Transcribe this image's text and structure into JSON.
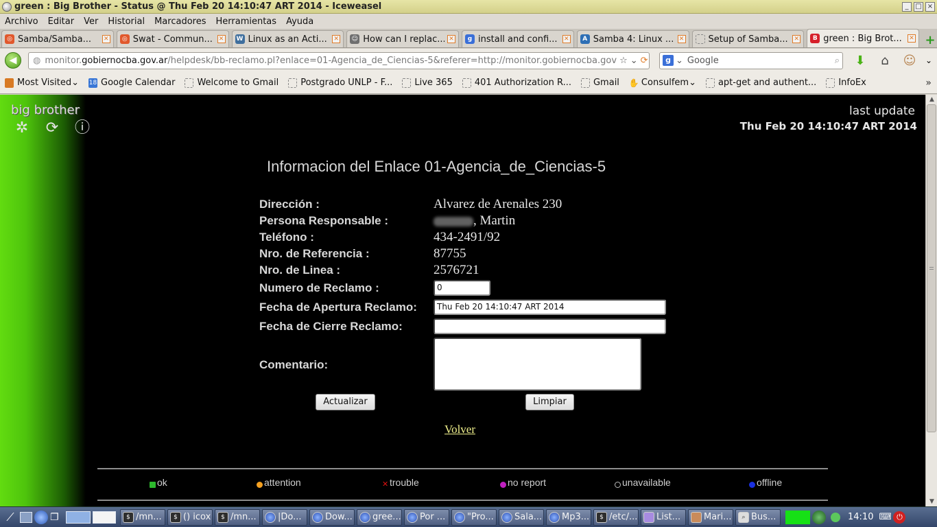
{
  "window": {
    "title": "green : Big Brother - Status @ Thu Feb 20 14:10:47 ART 2014 - Iceweasel",
    "buttons": [
      "_",
      "□",
      "×"
    ]
  },
  "menu": [
    "Archivo",
    "Editar",
    "Ver",
    "Historial",
    "Marcadores",
    "Herramientas",
    "Ayuda"
  ],
  "tabs": [
    {
      "label": "Samba/Samba..."
    },
    {
      "label": "Swat - Commun..."
    },
    {
      "label": "Linux as an Acti..."
    },
    {
      "label": "How can I replac..."
    },
    {
      "label": "install and confi..."
    },
    {
      "label": "Samba 4: Linux ..."
    },
    {
      "label": "Setup of Samba..."
    },
    {
      "label": "green : Big Brot...",
      "active": true
    }
  ],
  "nav": {
    "url_prefix": "monitor.",
    "url_host": "gobiernocba.gov.ar",
    "url_path": "/helpdesk/bb-reclamo.pl?enlace=01-Agencia_de_Ciencias-5&referer=http://monitor.gobiernocba.gov",
    "search_placeholder": "Google"
  },
  "bookmarks": [
    "Most Visited",
    "Google Calendar",
    "Welcome to Gmail",
    "Postgrado UNLP - F...",
    "Live 365",
    "401 Authorization R...",
    "Gmail",
    "Consulfem",
    "apt-get and authent...",
    "InfoEx"
  ],
  "page": {
    "brand": "big brother",
    "last_update_label": "last update",
    "last_update_value": "Thu Feb 20 14:10:47 ART 2014",
    "heading": "Informacion del Enlace 01-Agencia_de_Ciencias-5",
    "fields": {
      "direccion_label": "Dirección :",
      "direccion_value": "Alvarez de Arenales 230",
      "persona_label": "Persona Responsable :",
      "persona_value": ", Martin",
      "telefono_label": "Teléfono :",
      "telefono_value": "434-2491/92",
      "referencia_label": "Nro. de Referencia :",
      "referencia_value": "87755",
      "linea_label": "Nro. de Linea :",
      "linea_value": "2576721",
      "reclamo_label": "Numero de Reclamo :",
      "reclamo_value": "0",
      "apertura_label": "Fecha de Apertura Reclamo:",
      "apertura_value": "Thu Feb 20 14:10:47 ART 2014",
      "cierre_label": "Fecha de Cierre Reclamo:",
      "cierre_value": "",
      "comentario_label": "Comentario:",
      "comentario_value": ""
    },
    "actualizar": "Actualizar",
    "limpiar": "Limpiar",
    "volver": "Volver",
    "legend": [
      {
        "label": "ok",
        "color": "#2db82d"
      },
      {
        "label": "attention",
        "color": "#f5a020"
      },
      {
        "label": "trouble",
        "color": "#e01010"
      },
      {
        "label": "no report",
        "color": "#c020c0"
      },
      {
        "label": "unavailable",
        "color": "#bbbbbb"
      },
      {
        "label": "offline",
        "color": "#1a30e0"
      }
    ]
  },
  "taskbar": {
    "tasks": [
      "/mn...",
      "() icox",
      "/mn...",
      "|Do...",
      "Dow...",
      "gree...",
      "Por ...",
      "\"Pro...",
      "Sala...",
      "Mp3...",
      "/etc/...",
      "List...",
      "Mari...",
      "Bus..."
    ],
    "clock": "14:10"
  }
}
